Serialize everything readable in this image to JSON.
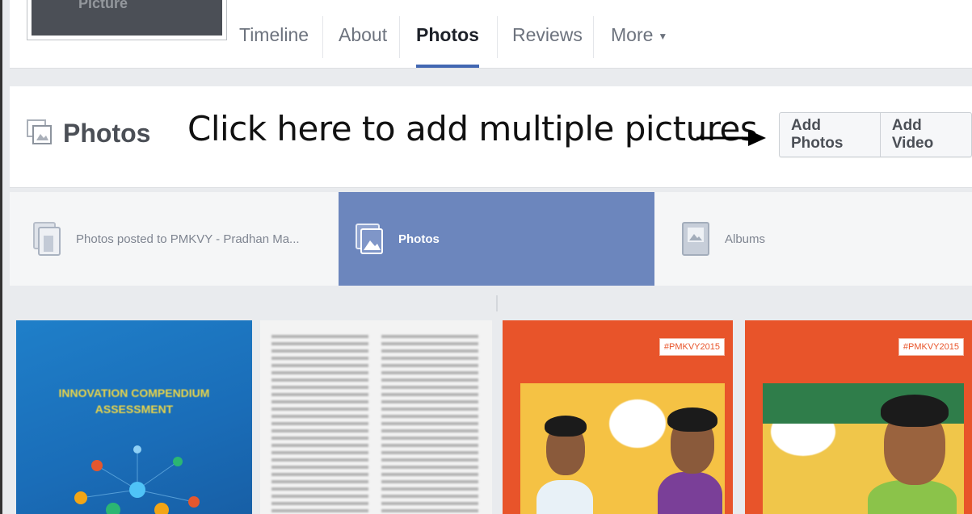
{
  "profile": {
    "picture_label": "Picture"
  },
  "nav": {
    "tabs": [
      "Timeline",
      "About",
      "Photos",
      "Reviews",
      "More"
    ],
    "active": "Photos"
  },
  "photos_section": {
    "title": "Photos",
    "annotation": "Click here to add multiple pictures",
    "add_photos": "Add Photos",
    "add_video": "Add Video"
  },
  "subtabs": [
    {
      "label": "Photos posted to PMKVY - Pradhan Ma...",
      "icon": "stacked-photos-icon"
    },
    {
      "label": "Photos",
      "icon": "photos-icon",
      "active": true
    },
    {
      "label": "Albums",
      "icon": "album-icon"
    }
  ],
  "grid": {
    "tile1_title_line1": "INNOVATION COMPENDIUM",
    "tile1_title_line2": "ASSESSMENT",
    "tile3_tag": "#PMKVY2015",
    "tile4_tag": "#PMKVY2015"
  },
  "colors": {
    "accent": "#4267b2",
    "active_subtab": "#6c86bd",
    "page_bg": "#e9ebee"
  }
}
